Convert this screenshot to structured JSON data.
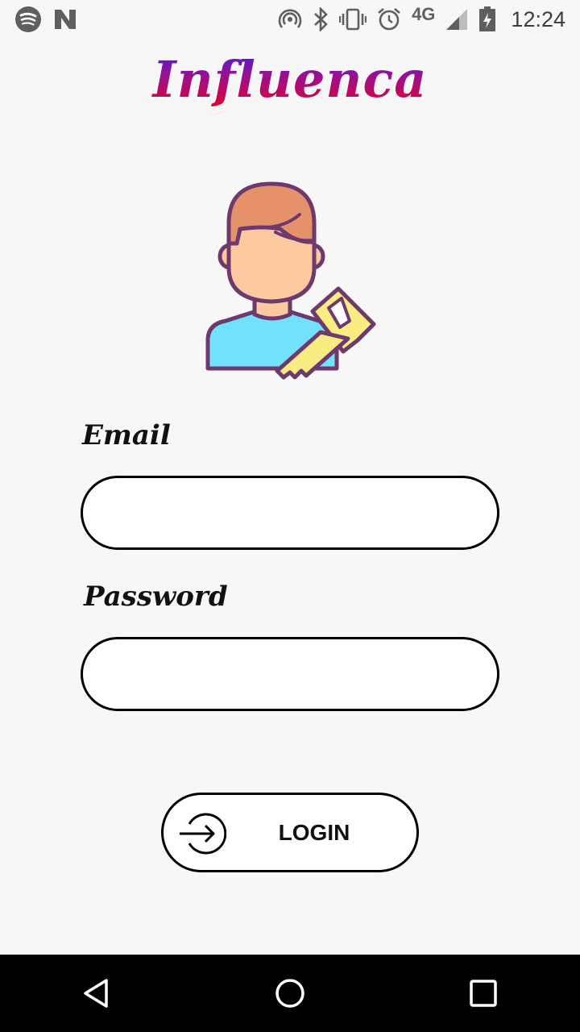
{
  "status_bar": {
    "network": "4G",
    "time": "12:24",
    "icons": [
      "spotify-icon",
      "n-notification-icon",
      "hotspot-icon",
      "bluetooth-icon",
      "vibrate-icon",
      "alarm-icon",
      "signal-icon",
      "battery-charging-icon"
    ]
  },
  "app": {
    "title": "Influenca"
  },
  "form": {
    "email_label": "Email",
    "email_value": "",
    "password_label": "Password",
    "password_value": "",
    "login_label": "LOGIN"
  },
  "nav": {
    "icons": [
      "back-icon",
      "home-icon",
      "recents-icon"
    ]
  },
  "colors": {
    "background": "#f7f7f7",
    "title_gradient": [
      "#4b1bd4",
      "#e3002a"
    ],
    "skin": "#fcc9a0",
    "hair": "#e5926a",
    "shirt": "#72e1fc",
    "key": "#f8ec83",
    "outline": "#6e3a6e"
  }
}
